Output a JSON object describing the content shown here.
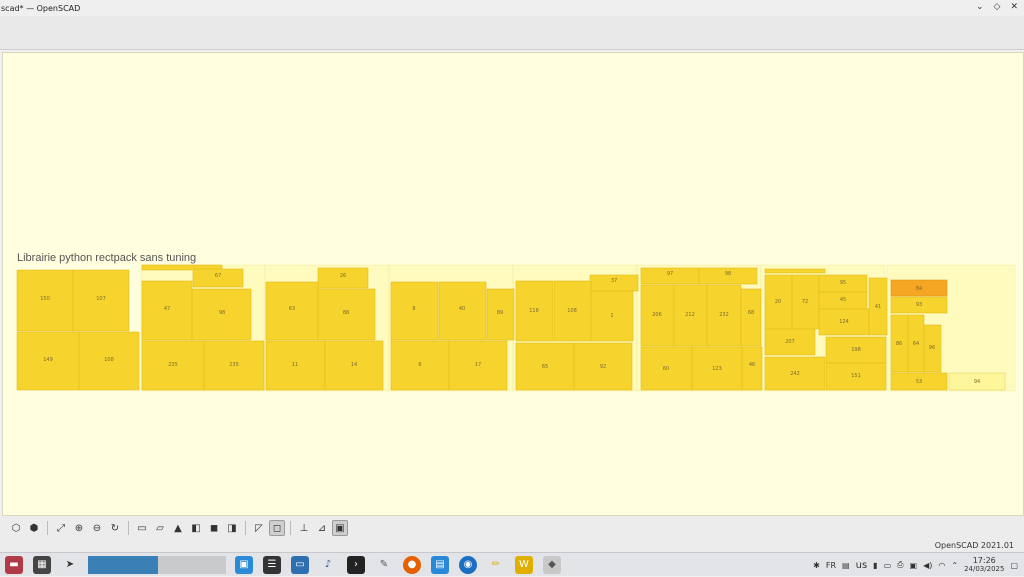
{
  "window": {
    "title": "scad* — OpenSCAD",
    "controls": {
      "minimize": "⌄",
      "maximize": "◇",
      "close": "✕"
    }
  },
  "viewport": {
    "label": "Librairie python rectpack sans tuning",
    "background": "#ffffe0",
    "rect_fill": "#f6d32d",
    "rect_highlight": "#f5a623",
    "rect_pale": "#fff59a"
  },
  "bottom_toolbar": {
    "buttons": [
      {
        "name": "preview",
        "glyph": "⬡"
      },
      {
        "name": "render",
        "glyph": "⬢"
      },
      {
        "name": "view-all",
        "glyph": "⤢"
      },
      {
        "name": "zoom-in",
        "glyph": "⊕"
      },
      {
        "name": "zoom-out",
        "glyph": "⊖"
      },
      {
        "name": "reset-view",
        "glyph": "↻"
      },
      {
        "name": "right",
        "glyph": "▭"
      },
      {
        "name": "top",
        "glyph": "▱"
      },
      {
        "name": "bottom",
        "glyph": "▲"
      },
      {
        "name": "left",
        "glyph": "◧"
      },
      {
        "name": "front",
        "glyph": "◼"
      },
      {
        "name": "back",
        "glyph": "◨"
      },
      {
        "name": "perspective",
        "glyph": "◸"
      },
      {
        "name": "orthogonal",
        "glyph": "◻"
      },
      {
        "name": "show-axes",
        "glyph": "⊥"
      },
      {
        "name": "show-scale",
        "glyph": "⊿"
      },
      {
        "name": "show-edges",
        "glyph": "▣"
      }
    ]
  },
  "status": {
    "version": "OpenSCAD 2021.01"
  },
  "taskbar": {
    "tray": {
      "lang": "FR",
      "keyboard": "us",
      "time": "17:26",
      "date": "24/03/2025"
    }
  }
}
